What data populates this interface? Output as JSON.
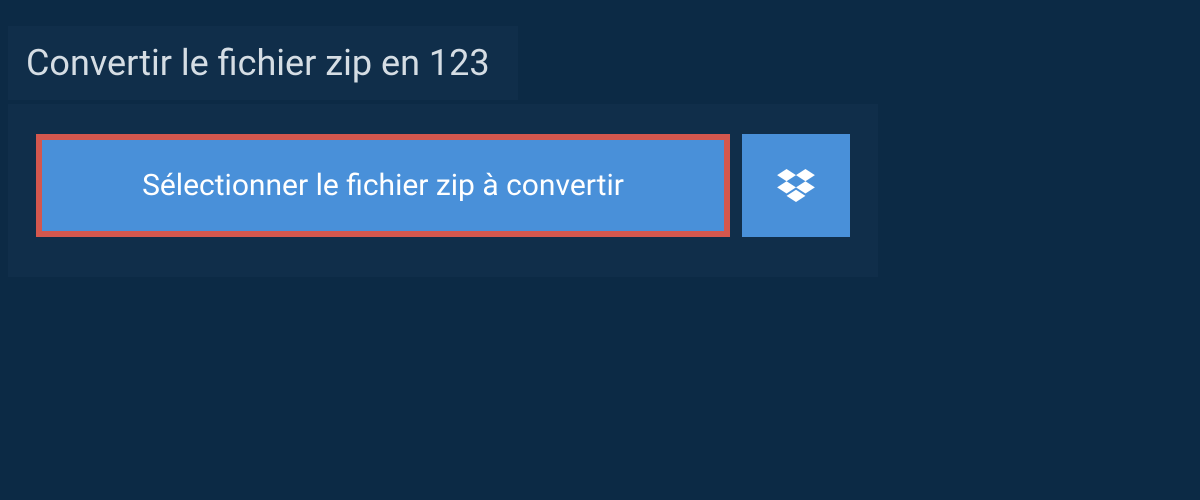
{
  "header": {
    "title": "Convertir le fichier zip en 123"
  },
  "actions": {
    "select_label": "Sélectionner le fichier zip à convertir"
  }
}
